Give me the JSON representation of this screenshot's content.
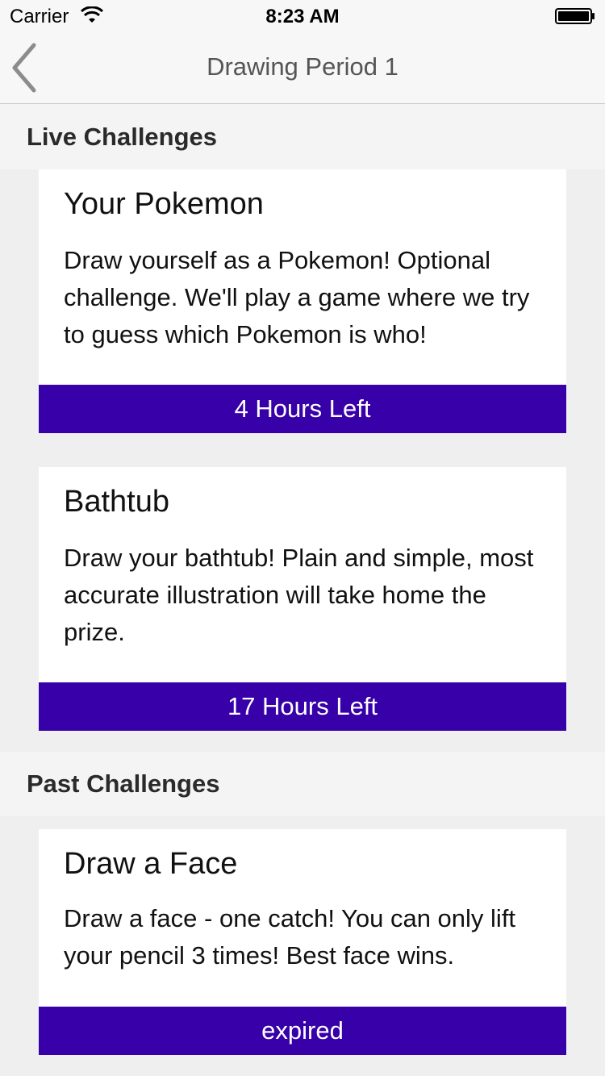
{
  "status_bar": {
    "carrier": "Carrier",
    "time": "8:23 AM"
  },
  "nav": {
    "title": "Drawing Period 1"
  },
  "sections": {
    "live": {
      "title": "Live Challenges",
      "cards": [
        {
          "title": "Your Pokemon",
          "description": "Draw yourself as a Pokemon! Optional challenge. We'll play a game where we try to guess which Pokemon is who!",
          "footer": "4 Hours Left"
        },
        {
          "title": "Bathtub",
          "description": "Draw your bathtub! Plain and simple, most accurate illustration will take home the prize.",
          "footer": "17 Hours Left"
        }
      ]
    },
    "past": {
      "title": "Past Challenges",
      "cards": [
        {
          "title": "Draw a Face",
          "description": "Draw a face - one catch! You can only lift your pencil 3 times! Best face wins.",
          "footer": "expired"
        }
      ]
    }
  },
  "colors": {
    "accent": "#3700a8",
    "background": "#f4f4f4",
    "card": "#ffffff"
  }
}
